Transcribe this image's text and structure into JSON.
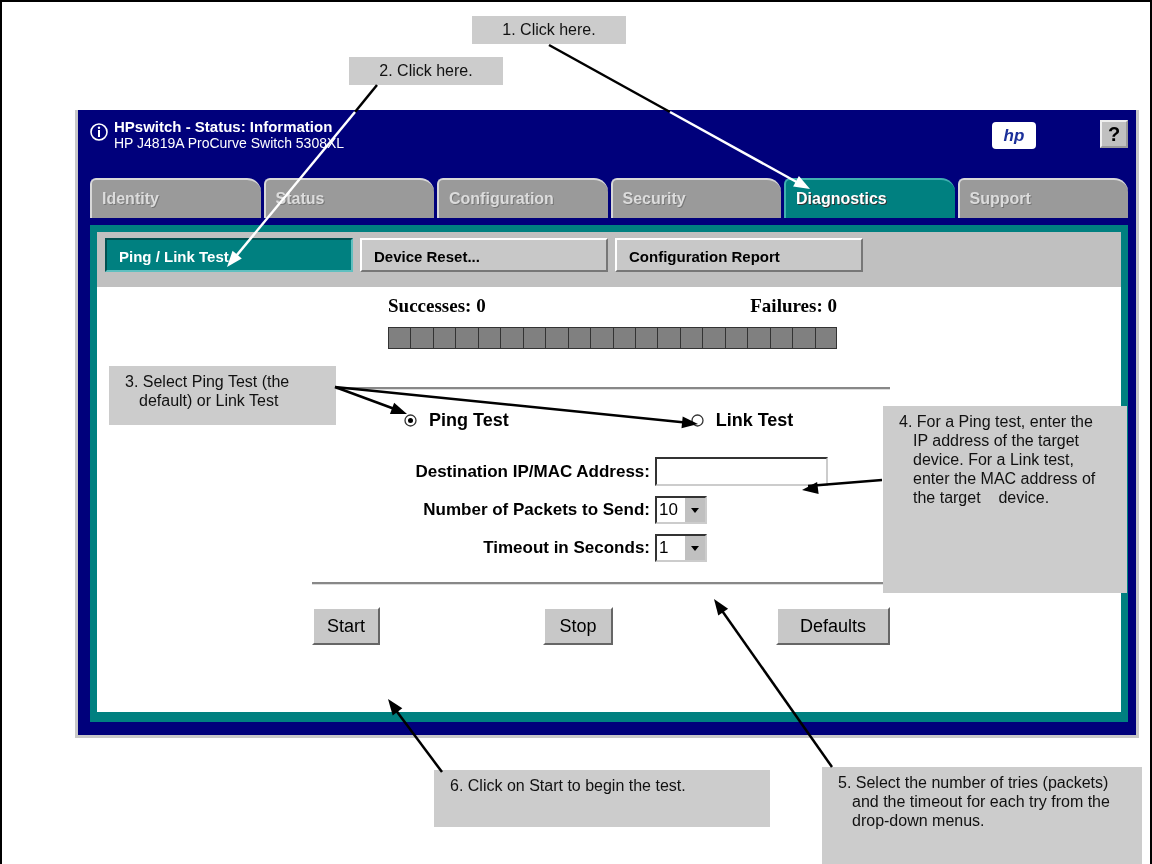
{
  "window": {
    "title": "HPswitch - Status: Information",
    "subtitle": "HP J4819A ProCurve Switch 5308XL",
    "logo": "hp",
    "help": "?"
  },
  "tabs": [
    {
      "label": "Identity",
      "selected": false
    },
    {
      "label": "Status",
      "selected": false
    },
    {
      "label": "Configuration",
      "selected": false
    },
    {
      "label": "Security",
      "selected": false
    },
    {
      "label": "Diagnostics",
      "selected": true
    },
    {
      "label": "Support",
      "selected": false
    }
  ],
  "subtabs": [
    {
      "label": "Ping / Link Test",
      "selected": true
    },
    {
      "label": "Device Reset...",
      "selected": false
    },
    {
      "label": "Configuration Report",
      "selected": false
    }
  ],
  "counters": {
    "successes": "Successes: 0",
    "failures": "Failures: 0"
  },
  "progress": {
    "level": 0
  },
  "test_types": [
    {
      "label": "Ping Test",
      "selected": true
    },
    {
      "label": "Link Test",
      "selected": false
    }
  ],
  "fields": [
    {
      "kind": "text",
      "label": "Destination IP/MAC Address:"
    },
    {
      "kind": "select",
      "label": "Number of Packets to Send:",
      "value": "10"
    },
    {
      "kind": "select",
      "label": "Timeout in Seconds:",
      "value": "1"
    }
  ],
  "buttons": [
    "Start",
    "Stop",
    "Defaults"
  ],
  "callouts": [
    {
      "text": "1. Click here."
    },
    {
      "text": "2. Click here."
    },
    {
      "text": "3. Select Ping Test (the default) or Link Test"
    },
    {
      "text": "4. For a Ping test, enter the IP address of the target device. For a Link test, enter the MAC address of the target    device."
    },
    {
      "text": "6. Click on Start to begin the test."
    },
    {
      "text": "5. Select the number of tries (packets) and the timeout for each try from the drop-down menus."
    }
  ]
}
